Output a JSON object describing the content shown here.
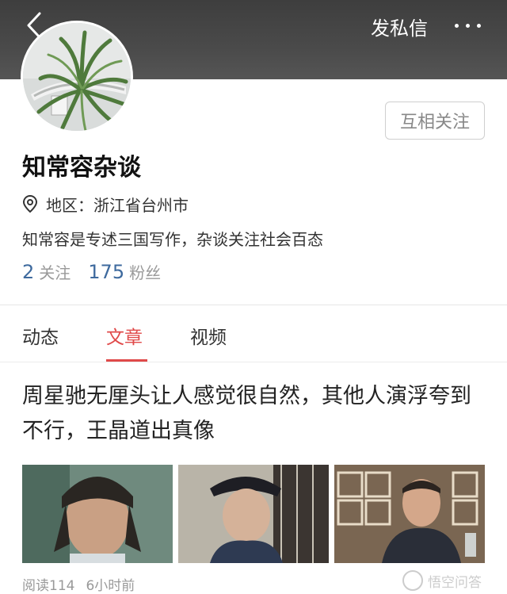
{
  "header": {
    "dm_label": "发私信",
    "back_icon": "chevron-left-icon",
    "more_icon": "more-dots-icon"
  },
  "profile": {
    "follow_label": "互相关注",
    "name": "知常容杂谈",
    "region": "地区：浙江省台州市",
    "region_icon": "location-pin-icon",
    "bio": "知常容是专述三国写作，杂谈关注社会百态",
    "following_count": "2",
    "following_label": "关注",
    "fans_count": "175",
    "fans_label": "粉丝"
  },
  "tabs": [
    {
      "label": "动态",
      "active": false
    },
    {
      "label": "文章",
      "active": true
    },
    {
      "label": "视频",
      "active": false
    }
  ],
  "article": {
    "title": "周星驰无厘头让人感觉很自然，其他人演浮夸到不行，王晶道出真像",
    "reads": "阅读114",
    "time": "6小时前"
  },
  "watermark": "悟空问答",
  "colors": {
    "accent": "#e04a4a",
    "link_blue": "#3e6a9e",
    "header_bg": "#444444"
  }
}
